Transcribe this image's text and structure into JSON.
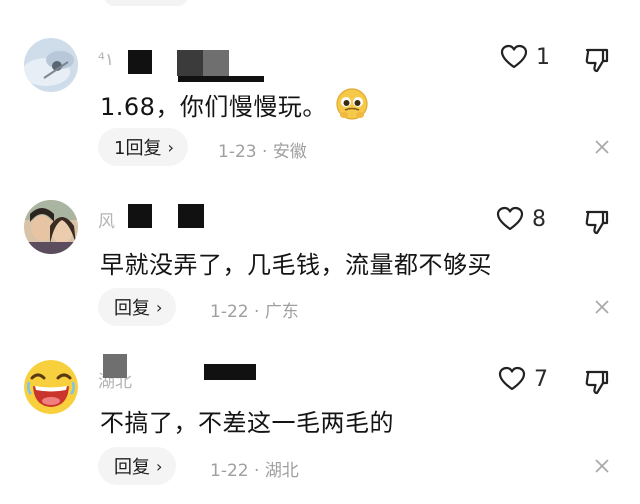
{
  "comments": [
    {
      "username": "⁴۱",
      "text": "1.68，你们慢慢玩。",
      "emoji": "pleading-face-emoji",
      "likes": "1",
      "reply_label": "1回复",
      "date": "1-23",
      "separator": "·",
      "location": "安徽"
    },
    {
      "username": "风",
      "text": "早就没弄了，几毛钱，流量都不够买",
      "likes": "8",
      "reply_label": "回复",
      "date": "1-22",
      "separator": "·",
      "location": "广东"
    },
    {
      "username": "湖北",
      "text": "不搞了，不差这一毛两毛的",
      "likes": "7",
      "reply_label": "回复",
      "date": "1-22",
      "separator": "·",
      "location": "湖北"
    }
  ],
  "icons": {
    "like": "heart-outline-icon",
    "dislike": "thumbs-down-icon",
    "close": "close-icon",
    "chevron": "›"
  },
  "colors": {
    "pill_bg": "#f4f4f4",
    "meta_text": "#9f9f9f",
    "emoji_yellow": "#f7c948"
  }
}
